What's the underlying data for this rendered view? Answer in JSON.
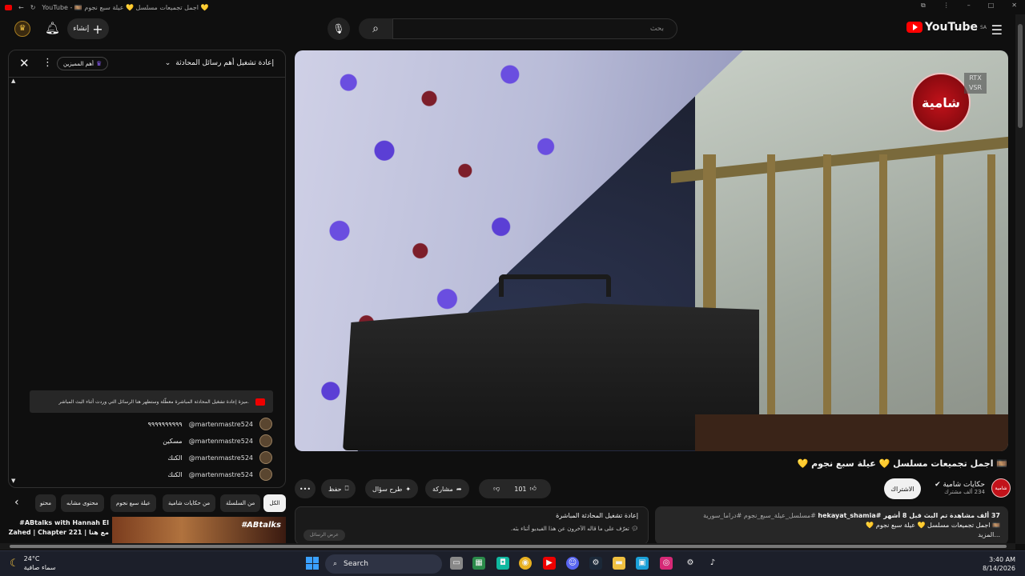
{
  "browser": {
    "tab_title": "YouTube - 🎞️ اجمل تجميعات مسلسل 💛 عيلة سبع نجوم 💛"
  },
  "header": {
    "logo_text": "YouTube",
    "region": "SA",
    "search_placeholder": "بحث",
    "create_label": "إنشاء"
  },
  "chat": {
    "title": "إعادة تشغيل أهم رسائل المحادثة",
    "badge": "أهم المميزين",
    "notice": "ميزة إعادة تشغيل المحادثة المباشرة معطّلة وستظهر هنا الرسائل التي وردت أثناء البث المباشر.",
    "messages": [
      {
        "author": "@martenmastre524",
        "text": "٩٩٩٩٩٩٩٩٩٩"
      },
      {
        "author": "@martenmastre524",
        "text": "مسكين"
      },
      {
        "author": "@martenmastre524",
        "text": "الكنك"
      },
      {
        "author": "@martenmastre524",
        "text": "الكنك"
      }
    ]
  },
  "chips": [
    "الكل",
    "من السلسلة",
    "من حكايات شامية",
    "عيلة سبع نجوم",
    "محتوى مشابه",
    "محتو"
  ],
  "recommendation": {
    "title": "#ABtalks with Hannah El Zahed | Chapter 221 | مع هنا",
    "thumb_tag": "#ABtalks"
  },
  "video": {
    "title": "🎞️ اجمل تجميعات مسلسل 💛 عيلة سبع نجوم 💛",
    "channel_logo_text": "شامية",
    "rtx_line1": "RTX",
    "rtx_line2": "VSR"
  },
  "owner": {
    "channel": "حكايات شامية",
    "subscribers": "234 ألف مشترك",
    "subscribe": "الاشتراك",
    "avatar_text": "شامية"
  },
  "actions": {
    "likes": "101",
    "share": "مشاركة",
    "ask": "طرح سؤال",
    "save": "حفظ",
    "more": "•••"
  },
  "description": {
    "meta": "37 ألف مشاهدة  تم البث قبل 8 أشهر  #hekayat_shamia",
    "tags": "#مسلسل_عيلة_سبع_نجوم #دراما_سورية",
    "line2": "🎞️ اجمل تجميعات مسلسل 💛 عيلة سبع نجوم 💛",
    "more": "...المزيد"
  },
  "replay_card": {
    "title": "إعادة تشغيل المحادثة المباشرة",
    "subtitle": "تعرّف على ما قاله الآخرون عن هذا الفيديو أثناء بثه.",
    "button": "عرض الرسائل"
  },
  "taskbar": {
    "temp": "24°C",
    "condition": "سماء صافية",
    "search": "Search",
    "time": "3:40 AM",
    "date": "8/14/2026"
  }
}
